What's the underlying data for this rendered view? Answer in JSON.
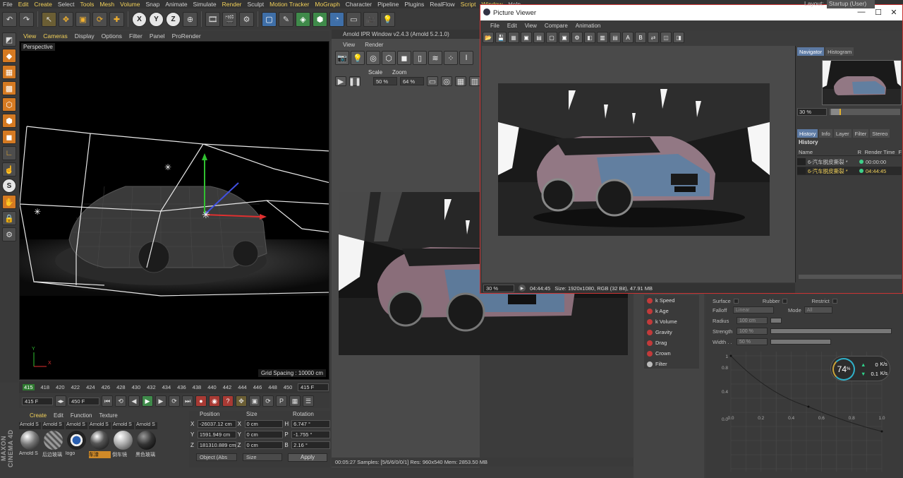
{
  "menubar": {
    "items": [
      "File",
      "Edit",
      "Create",
      "Select",
      "Tools",
      "Mesh",
      "Volume",
      "Snap",
      "Animate",
      "Simulate",
      "Render",
      "Sculpt",
      "Motion Tracker",
      "MoGraph",
      "Character",
      "Pipeline",
      "Plugins",
      "RealFlow",
      "Script",
      "Window",
      "Help"
    ],
    "highlighted": [
      "Edit",
      "Create",
      "Tools",
      "Mesh",
      "Volume",
      "Render",
      "Motion Tracker",
      "MoGraph",
      "Script",
      "Window"
    ],
    "layout_label": "Layout:",
    "layout_value": "Startup (User)"
  },
  "toolbar": {
    "axis_x": "X",
    "axis_y": "Y",
    "axis_z": "Z"
  },
  "viewport": {
    "menu": [
      "View",
      "Cameras",
      "Display",
      "Options",
      "Filter",
      "Panel",
      "ProRender"
    ],
    "menu_highlight": [
      "View",
      "Cameras"
    ],
    "label": "Perspective",
    "grid_spacing": "Grid Spacing : 10000 cm",
    "axis_x": "X",
    "axis_y": "Y"
  },
  "timeline": {
    "frames": [
      "415",
      "418",
      "420",
      "422",
      "424",
      "426",
      "428",
      "430",
      "432",
      "434",
      "436",
      "438",
      "440",
      "442",
      "444",
      "446",
      "448",
      "450"
    ],
    "current_frame": "415 F"
  },
  "transport": {
    "start": "415 F",
    "end": "450 F"
  },
  "materials": {
    "tabs": [
      "Create",
      "Edit",
      "Function",
      "Texture"
    ],
    "tab_highlight": [
      "Create"
    ],
    "top_names": [
      "Arnold S",
      "Arnold S",
      "Arnold S",
      "Arnold S",
      "Arnold S",
      "Arnold S"
    ],
    "bottom_names": [
      "Arnold S",
      "后边玻璃",
      "logo",
      "车漆",
      "倒车镜",
      "黑色玻璃"
    ],
    "selected_index": 3
  },
  "coordinates": {
    "headers": [
      "Position",
      "Size",
      "Rotation"
    ],
    "rows": [
      {
        "axis": "X",
        "pos": "-26037.12 cm",
        "size_axis": "X",
        "size": "0 cm",
        "rot_axis": "H",
        "rot": "6.747 °"
      },
      {
        "axis": "Y",
        "pos": "1591.949 cm",
        "size_axis": "Y",
        "size": "0 cm",
        "rot_axis": "P",
        "rot": "-1.755 °"
      },
      {
        "axis": "Z",
        "pos": "181310.889 cm",
        "size_axis": "Z",
        "size": "0 cm",
        "rot_axis": "B",
        "rot": "2.16 °"
      }
    ],
    "mode": "Object (Abs",
    "size_mode": "Size",
    "apply": "Apply"
  },
  "ipr": {
    "title": "Arnold IPR Window v2.4.3 (Arnold 5.2.1.0)",
    "menu": [
      "View",
      "Render"
    ],
    "scale_label": "Scale",
    "zoom_label": "Zoom",
    "scale_value": "50 %",
    "zoom_value": "64 %",
    "status": "00:05:27   Samples: [5/6/6/0/0/1]   Res: 960x540   Mem: 2853.50 MB"
  },
  "picture_viewer": {
    "title": "Picture Viewer",
    "menu": [
      "File",
      "Edit",
      "View",
      "Compare",
      "Animation"
    ],
    "zoom": "30 %",
    "time": "04:44:45",
    "info": "Size: 1920x1080, RGB (32 Bit), 47.91 MB",
    "side_tabs_top": [
      "Navigator",
      "Histogram"
    ],
    "nav_zoom": "30 %",
    "side_tabs": [
      "History",
      "Info",
      "Layer",
      "Filter",
      "Stereo"
    ],
    "history_title": "History",
    "history_cols": [
      "Name",
      "R",
      "Render Time",
      "F"
    ],
    "history_rows": [
      {
        "name": "6-汽车脱皮撕裂 *",
        "time": "00:00:00",
        "active": false
      },
      {
        "name": "6-汽车脱皮撕裂 *",
        "time": "04:44:45",
        "active": true
      }
    ]
  },
  "particles": {
    "items": [
      "k Speed",
      "k Age",
      "k Volume",
      "Gravity",
      "Drag",
      "Crown",
      "Filter"
    ]
  },
  "attributes": {
    "surface": "Surface",
    "rubber": "Rubber",
    "restrict": "Restrict",
    "falloff_label": "Falloff",
    "falloff_value": "Linear",
    "mode_label": "Mode",
    "mode_value": "All",
    "radius_label": "Radius",
    "radius_value": "100 cm",
    "strength_label": "Strength",
    "strength_value": "100 %",
    "width_label": "Width . .",
    "width_value": "50 %",
    "graph_y": [
      "1",
      "0.8",
      "0.4",
      "0.0"
    ],
    "graph_x": [
      "0.0",
      "0.2",
      "0.4",
      "0.6",
      "0.8",
      "1.0"
    ]
  },
  "perf": {
    "percent": "74",
    "unit": "%",
    "up": "0",
    "down": "0.1",
    "rate_unit": "K/s"
  },
  "colors": {
    "accent": "#f2d15a",
    "selection": "#5d7aa3",
    "orange": "#d08a28"
  }
}
